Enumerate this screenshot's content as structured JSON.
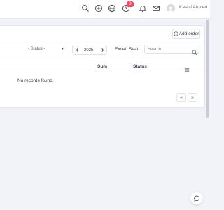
{
  "topbar": {
    "notification_count": "3",
    "user_name": "Kashif Ahmed"
  },
  "orders": {
    "add_order_label": "Add order",
    "status_filter": "- Status -",
    "year": "2025",
    "export_excel_label": "Excel",
    "seal_label": "Seal",
    "search_placeholder": "Search",
    "columns": {
      "sum": "Sum",
      "status": "Status"
    },
    "empty_message": "No records found."
  },
  "pagination": {
    "prev_label": "«",
    "next_label": "»"
  },
  "colors": {
    "badge": "#f0465a",
    "background": "#f2f3f9",
    "card": "#ffffff"
  },
  "icons": [
    "search-icon",
    "plus-circle-icon",
    "globe-icon",
    "clock-icon",
    "bell-icon",
    "mail-icon",
    "avatar",
    "chevron-left-icon",
    "chevron-right-icon",
    "columns-icon",
    "chat-icon"
  ]
}
